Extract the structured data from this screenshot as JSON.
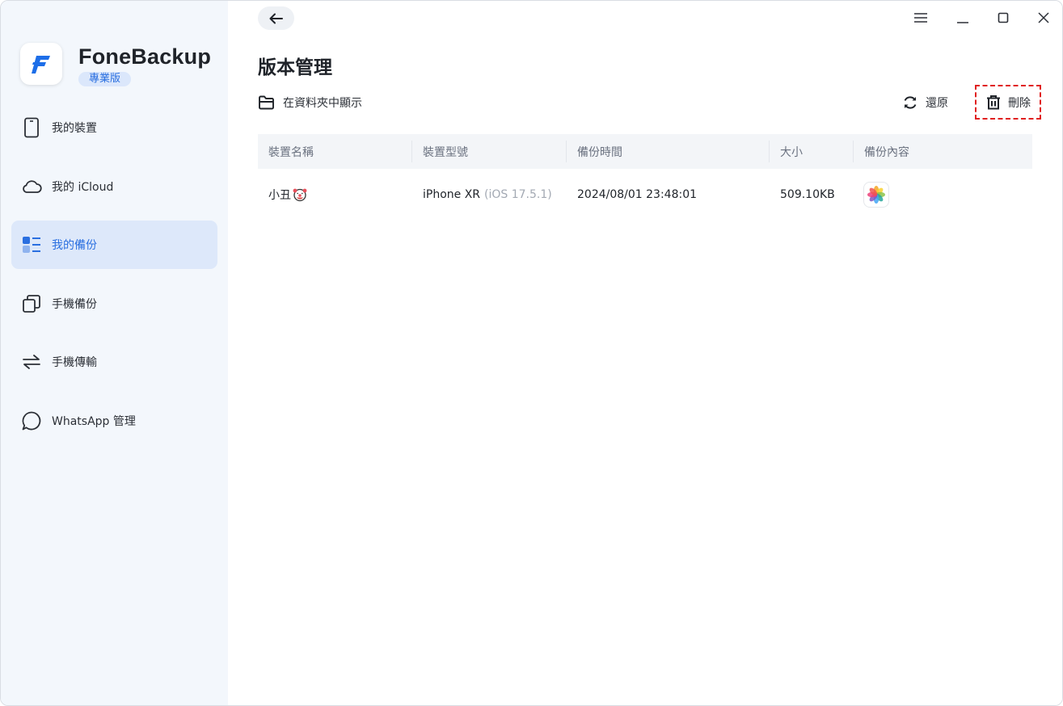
{
  "app": {
    "name": "FoneBackup",
    "edition": "專業版"
  },
  "sidebar": {
    "items": [
      {
        "label": "我的裝置",
        "icon": "phone-icon",
        "active": false
      },
      {
        "label": "我的 iCloud",
        "icon": "cloud-icon",
        "active": false
      },
      {
        "label": "我的備份",
        "icon": "list-icon",
        "active": true
      },
      {
        "label": "手機備份",
        "icon": "copy-icon",
        "active": false
      },
      {
        "label": "手機傳輸",
        "icon": "transfer-arrows-icon",
        "active": false
      },
      {
        "label": "WhatsApp 管理",
        "icon": "chat-bubble-icon",
        "active": false
      }
    ]
  },
  "header": {
    "title": "版本管理"
  },
  "toolbar": {
    "show_in_folder": "在資料夾中顯示",
    "restore": "還原",
    "delete": "刪除"
  },
  "table": {
    "columns": [
      "裝置名稱",
      "裝置型號",
      "備份時間",
      "大小",
      "備份內容"
    ],
    "rows": [
      {
        "device_name": "小丑",
        "device_name_emoji": "clown-face-icon",
        "model": "iPhone XR",
        "os": "(iOS 17.5.1)",
        "time": "2024/08/01 23:48:01",
        "size": "509.10KB",
        "content_icon": "photos-app-icon"
      }
    ]
  },
  "colors": {
    "accent": "#2a6fe0",
    "active_bg": "#dde8fa",
    "sidebar_bg": "#f3f7fc",
    "highlight_border": "#e02020"
  }
}
